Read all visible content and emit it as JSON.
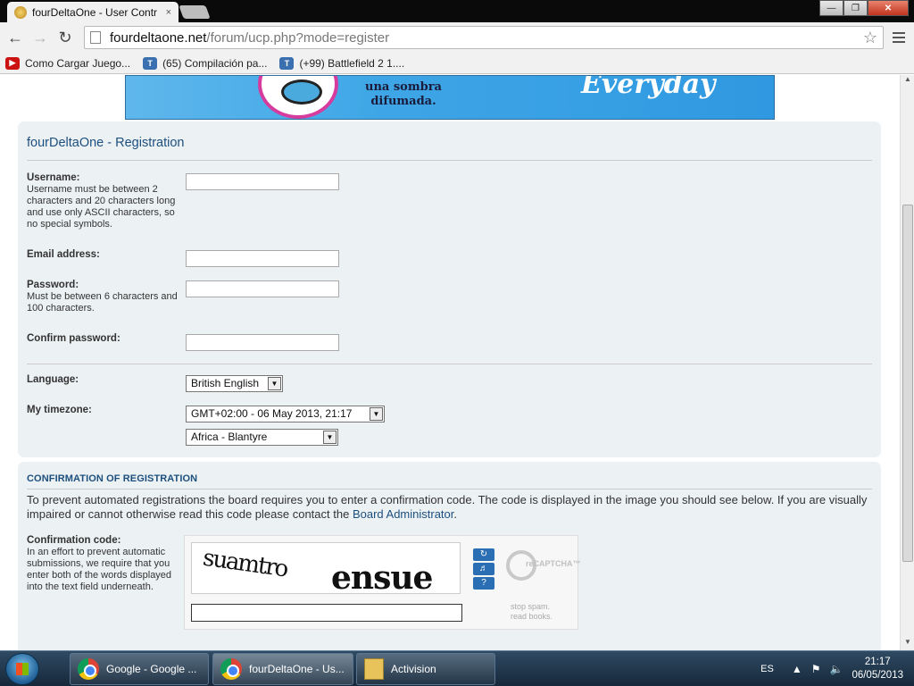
{
  "browser": {
    "tab_title": "fourDeltaOne - User Contr",
    "tab_close": "×",
    "window_buttons": {
      "minimize": "—",
      "restore": "❐",
      "close": "✕"
    },
    "url_host": "fourdeltaone.net",
    "url_path": "/forum/ucp.php?mode=register",
    "bookmarks": [
      {
        "label": "Como Cargar Juego...",
        "icon": "youtube-icon",
        "glyph": "▶"
      },
      {
        "label": "(65) Compilación pa...",
        "icon": "t-icon",
        "glyph": "T"
      },
      {
        "label": "(+99) Battlefield 2 1....",
        "icon": "t-icon",
        "glyph": "T"
      }
    ]
  },
  "banner": {
    "line1": "una sombra",
    "line2": "difumada.",
    "brand": "Everyday"
  },
  "registration": {
    "title": "fourDeltaOne - Registration",
    "username_label": "Username:",
    "username_help": "Username must be between 2 characters and 20 characters long and use only ASCII characters, so no special symbols.",
    "email_label": "Email address:",
    "password_label": "Password:",
    "password_help": "Must be between 6 characters and 100 characters.",
    "confirm_label": "Confirm password:",
    "language_label": "Language:",
    "language_value": "British English",
    "timezone_label": "My timezone:",
    "timezone_value": "GMT+02:00 - 06 May 2013, 21:17",
    "region_value": "Africa - Blantyre"
  },
  "confirmation": {
    "heading": "CONFIRMATION OF REGISTRATION",
    "text": "To prevent automated registrations the board requires you to enter a confirmation code. The code is displayed in the image you should see below. If you are visually impaired or cannot otherwise read this code please contact the ",
    "link": "Board Administrator",
    "text_end": ".",
    "code_label": "Confirmation code:",
    "code_help": "In an effort to prevent automatic submissions, we require that you enter both of the words displayed into the text field underneath.",
    "captcha_word1": "suamtro",
    "captcha_word2": "ensue",
    "recaptcha_logo": "reCAPTCHA™",
    "tagline1": "stop spam.",
    "tagline2": "read books."
  },
  "taskbar": {
    "tasks": [
      {
        "label": "Google - Google ...",
        "icon": "chrome-icon"
      },
      {
        "label": "fourDeltaOne - Us...",
        "icon": "chrome-icon"
      },
      {
        "label": "Activision",
        "icon": "folder-icon"
      }
    ],
    "lang": "ES",
    "time": "21:17",
    "date": "06/05/2013"
  }
}
